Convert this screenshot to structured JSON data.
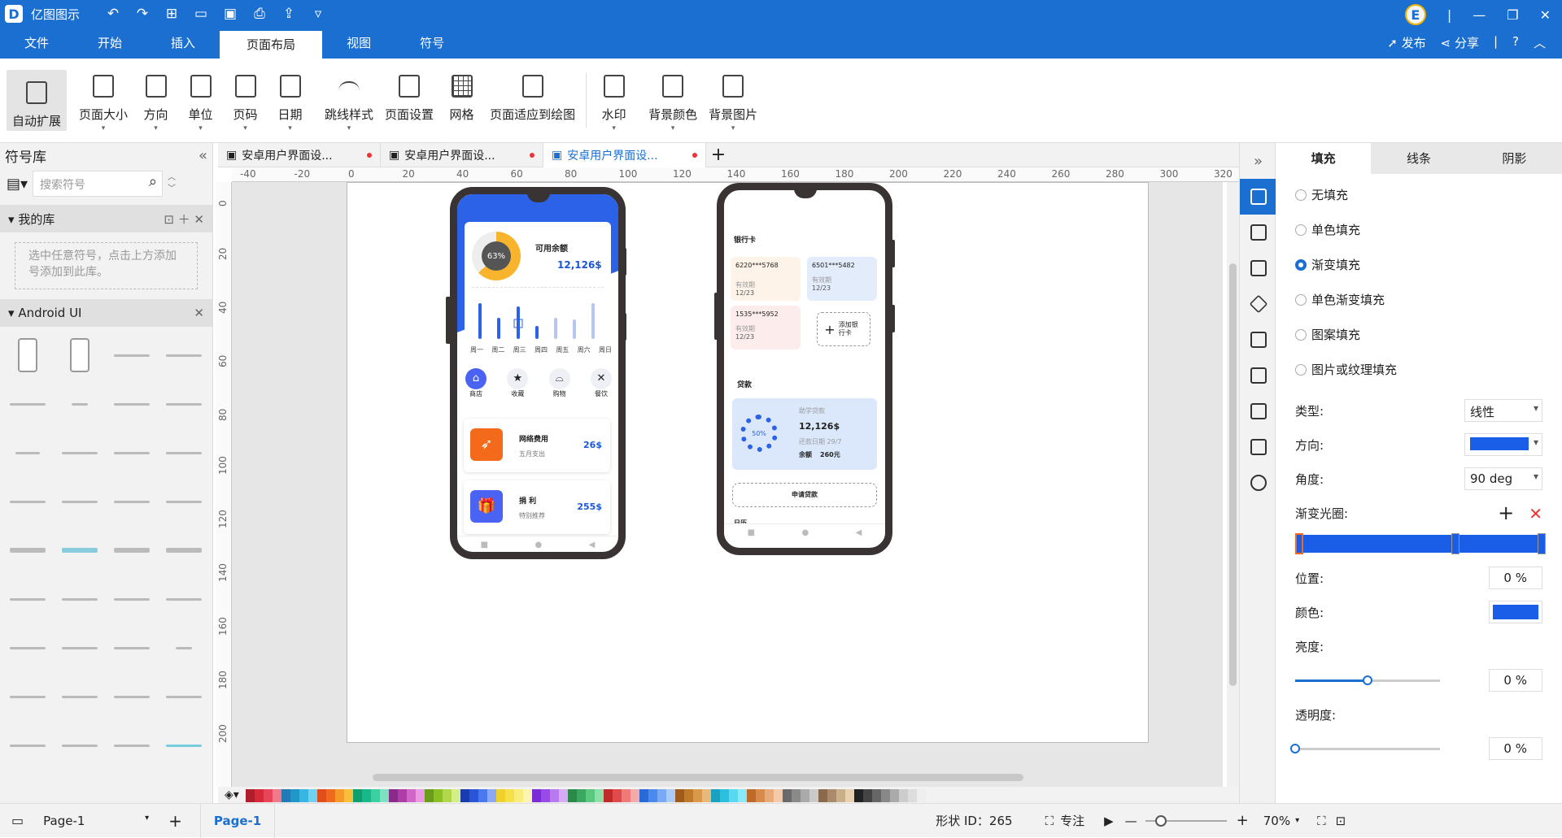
{
  "app": {
    "title": "亿图图示",
    "logo": "D"
  },
  "window": {
    "user_initial": "E"
  },
  "menu": {
    "items": [
      "文件",
      "开始",
      "插入",
      "页面布局",
      "视图",
      "符号"
    ],
    "active": "页面布局",
    "publish": "发布",
    "share": "分享",
    "help": "?"
  },
  "ribbon": {
    "buttons": [
      {
        "label": "自动扩展",
        "icon": "auto-expand-icon"
      },
      {
        "label": "页面大小",
        "icon": "page-size-icon"
      },
      {
        "label": "方向",
        "icon": "orientation-icon"
      },
      {
        "label": "单位",
        "icon": "unit-icon"
      },
      {
        "label": "页码",
        "icon": "page-number-icon"
      },
      {
        "label": "日期",
        "icon": "date-icon"
      },
      {
        "label": "跳线样式",
        "icon": "jump-line-icon"
      },
      {
        "label": "页面设置",
        "icon": "page-setup-icon"
      },
      {
        "label": "网格",
        "icon": "grid-icon"
      },
      {
        "label": "页面适应到绘图",
        "icon": "fit-page-icon"
      },
      {
        "label": "水印",
        "icon": "watermark-icon"
      },
      {
        "label": "背景颜色",
        "icon": "bg-color-icon"
      },
      {
        "label": "背景图片",
        "icon": "bg-image-icon"
      }
    ]
  },
  "left": {
    "title": "符号库",
    "search_placeholder": "搜索符号",
    "mylib": "我的库",
    "mylib_hint": "选中任意符号，点击上方添加号添加到此库。",
    "section": "Android UI"
  },
  "tabs": [
    {
      "label": "安卓用户界面设..."
    },
    {
      "label": "安卓用户界面设..."
    },
    {
      "label": "安卓用户界面设..."
    }
  ],
  "ruler_h": [
    "-40",
    "-20",
    "0",
    "20",
    "40",
    "60",
    "80",
    "100",
    "120",
    "140",
    "160",
    "180",
    "200",
    "220",
    "240",
    "260",
    "280",
    "300",
    "320"
  ],
  "ruler_v": [
    "0",
    "20",
    "40",
    "60",
    "80",
    "100",
    "120",
    "140",
    "160",
    "180",
    "200"
  ],
  "phone1": {
    "donut_pct": "63%",
    "donut_value": 0.63,
    "balance_label": "可用余额",
    "balance": "12,126$",
    "days": [
      "周一",
      "周二",
      "周三",
      "周四",
      "周五",
      "周六",
      "周日"
    ],
    "icons": [
      {
        "label": "商店"
      },
      {
        "label": "收藏"
      },
      {
        "label": "购物"
      },
      {
        "label": "餐饮"
      }
    ],
    "items": [
      {
        "title": "网络费用",
        "sub": "五月支出",
        "amount": "26$",
        "color": "#f36a1a"
      },
      {
        "title": "捐 利",
        "sub": "特别推荐",
        "amount": "255$",
        "color": "#4b63f2"
      }
    ]
  },
  "phone2": {
    "title": "银行卡",
    "cards": [
      {
        "num": "6220***5768",
        "exp_label": "有效期",
        "exp": "12/23",
        "bg": "#fdf3e8"
      },
      {
        "num": "6501***5482",
        "exp_label": "有效期",
        "exp": "12/23",
        "bg": "#e3ecfb"
      },
      {
        "num": "1535***5952",
        "exp_label": "有效期",
        "exp": "12/23",
        "bg": "#fcecec"
      }
    ],
    "add_card": "添加银行卡",
    "loan_title": "贷款",
    "loan": {
      "label": "助学贷款",
      "amount": "12,126$",
      "due": "还款日期 29/7",
      "remain_label": "余额",
      "remain": "260元",
      "pct": "50%"
    },
    "apply": "申请贷款",
    "footer": "日历"
  },
  "right": {
    "tabs": [
      "填充",
      "线条",
      "阴影"
    ],
    "fills": [
      "无填充",
      "单色填充",
      "渐变填充",
      "单色渐变填充",
      "图案填充",
      "图片或纹理填充"
    ],
    "selected_fill": "渐变填充",
    "type_label": "类型:",
    "type_value": "线性",
    "dir_label": "方向:",
    "angle_label": "角度:",
    "angle_value": "90 deg",
    "stops_label": "渐变光圈:",
    "pos_label": "位置:",
    "pos_value": "0 %",
    "color_label": "颜色:",
    "bright_label": "亮度:",
    "bright_value": "0 %",
    "bright_level": 0.5,
    "alpha_label": "透明度:",
    "alpha_value": "0 %",
    "accent": "#1a5ee8"
  },
  "status": {
    "page_select": "Page-1",
    "page_tab": "Page-1",
    "shape_id": "形状 ID：265",
    "focus": "专注",
    "zoom": "70%"
  }
}
